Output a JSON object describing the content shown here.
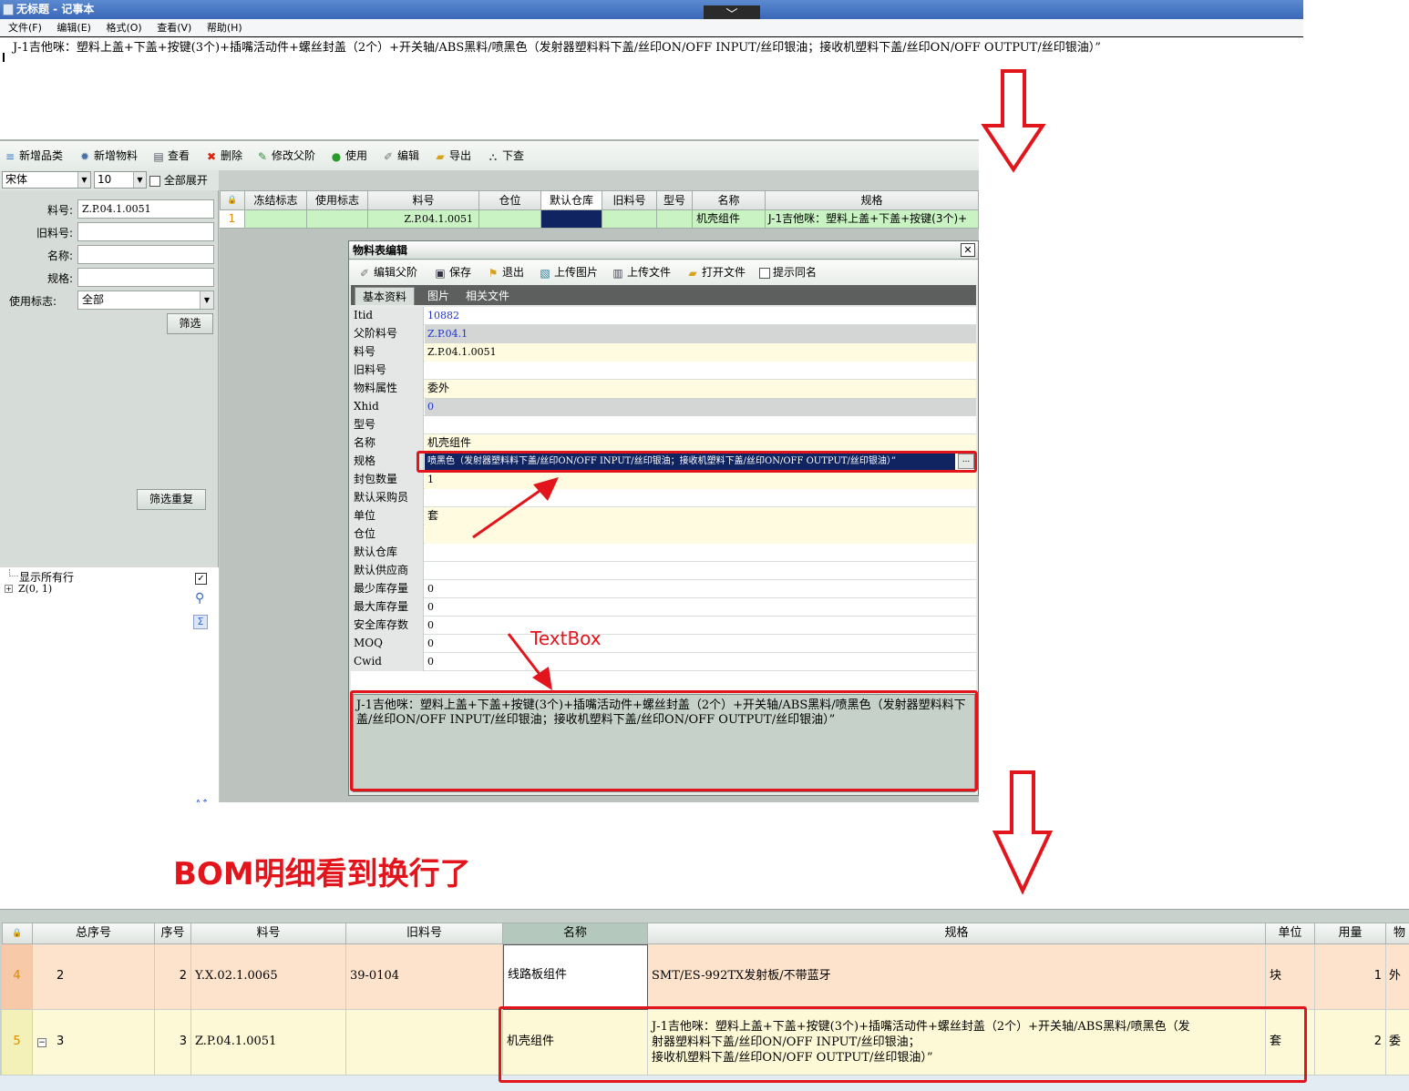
{
  "notepad": {
    "title": "无标题 - 记事本",
    "menu": [
      "文件(F)",
      "编辑(E)",
      "格式(O)",
      "查看(V)",
      "帮助(H)"
    ],
    "chevron": "﹀",
    "content": "J-1吉他咪：塑料上盖+下盖+按键(3个)+插嘴活动件+螺丝封盖（2个）+开关轴/ABS黑料/喷黑色（发射器塑料料下盖/丝印ON/OFF  INPUT/丝印银油；接收机塑料下盖/丝印ON/OFF  OUTPUT/丝印银油）”"
  },
  "toolbar": {
    "add_category": "新增品类",
    "add_material": "新增物料",
    "view": "查看",
    "delete": "删除",
    "edit_parent": "修改父阶",
    "use": "使用",
    "edit": "编辑",
    "export": "导出",
    "lookup": "下查"
  },
  "fontrow": {
    "font": "宋体",
    "size": "10",
    "expand_all": "全部展开"
  },
  "filter": {
    "code_label": "料号:",
    "code_value": "Z.P.04.1.0051",
    "old_label": "旧料号:",
    "name_label": "名称:",
    "spec_label": "规格:",
    "use_label": "使用标志:",
    "use_value": "全部",
    "filter_button": "筛选",
    "reset_button": "筛选重复"
  },
  "tree": {
    "show_all": "显示所有行",
    "node": "Z(0, 1)"
  },
  "grid": {
    "headers": [
      "冻结标志",
      "使用标志",
      "料号",
      "仓位",
      "默认仓库",
      "旧料号",
      "型号",
      "名称",
      "规格"
    ],
    "row_num": "1",
    "row_code": "Z.P.04.1.0051",
    "row_name": "机壳组件",
    "row_spec": "J-1吉他咪：塑料上盖+下盖+按键(3个)+"
  },
  "dialog": {
    "title": "物料表编辑",
    "close": "✕",
    "toolbar": {
      "edit_parent": "编辑父阶",
      "save": "保存",
      "exit": "退出",
      "upload_image": "上传图片",
      "upload_file": "上传文件",
      "open_file": "打开文件",
      "same_name_hint": "提示同名"
    },
    "tabs": [
      "基本资料",
      "图片",
      "相关文件"
    ],
    "props": [
      {
        "k": "Itid",
        "v": "10882"
      },
      {
        "k": "父阶料号",
        "v": "Z.P.04.1"
      },
      {
        "k": "料号",
        "v": "Z.P.04.1.0051"
      },
      {
        "k": "旧料号",
        "v": ""
      },
      {
        "k": "物料属性",
        "v": "委外"
      },
      {
        "k": "Xhid",
        "v": "0"
      },
      {
        "k": "型号",
        "v": ""
      },
      {
        "k": "名称",
        "v": "机壳组件"
      },
      {
        "k": "规格",
        "v": "喷黑色（发射器塑料料下盖/丝印ON/OFF  INPUT/丝印银油；接收机塑料下盖/丝印ON/OFF  OUTPUT/丝印银油）”"
      },
      {
        "k": "封包数量",
        "v": "1"
      },
      {
        "k": "默认采购员",
        "v": ""
      },
      {
        "k": "单位",
        "v": "套"
      },
      {
        "k": "仓位",
        "v": ""
      },
      {
        "k": "默认仓库",
        "v": ""
      },
      {
        "k": "默认供应商",
        "v": ""
      },
      {
        "k": "最少库存量",
        "v": "0"
      },
      {
        "k": "最大库存量",
        "v": "0"
      },
      {
        "k": "安全库存数",
        "v": "0"
      },
      {
        "k": "MOQ",
        "v": "0"
      },
      {
        "k": "Cwid",
        "v": "0"
      }
    ],
    "ellipsis": "...",
    "textbox": "J-1吉他咪：塑料上盖+下盖+按键(3个)+插嘴活动件+螺丝封盖（2个）+开关轴/ABS黑料/喷黑色（发射器塑料料下盖/丝印ON/OFF  INPUT/丝印银油；接收机塑料下盖/丝印ON/OFF  OUTPUT/丝印银油）”"
  },
  "annotations": {
    "textbox_label": "TextBox",
    "caption": "BOM明细看到换行了",
    "accent": "#e3151c"
  },
  "bom": {
    "headers": [
      "总序号",
      "序号",
      "料号",
      "旧料号",
      "名称",
      "规格",
      "单位",
      "用量",
      "物"
    ],
    "rows": [
      {
        "rownum": "4",
        "total": "2",
        "seq": "2",
        "code": "Y.X.02.1.0065",
        "old": "39-0104",
        "name": "线路板组件",
        "spec": "SMT/ES-992TX发射板/不带蓝牙",
        "unit": "块",
        "qty": "1",
        "attr": "外"
      },
      {
        "rownum": "5",
        "total": "3",
        "seq": "3",
        "code": "Z.P.04.1.0051",
        "old": "",
        "name": "机壳组件",
        "spec_l1": "J-1吉他咪：塑料上盖+下盖+按键(3个)+插嘴活动件+螺丝封盖（2个）+开关轴/ABS黑料/喷黑色（发",
        "spec_l2": "射器塑料料下盖/丝印ON/OFF  INPUT/丝印银油；",
        "spec_l3": "接收机塑料下盖/丝印ON/OFF  OUTPUT/丝印银油）”",
        "unit": "套",
        "qty": "2",
        "attr": "委"
      }
    ]
  }
}
